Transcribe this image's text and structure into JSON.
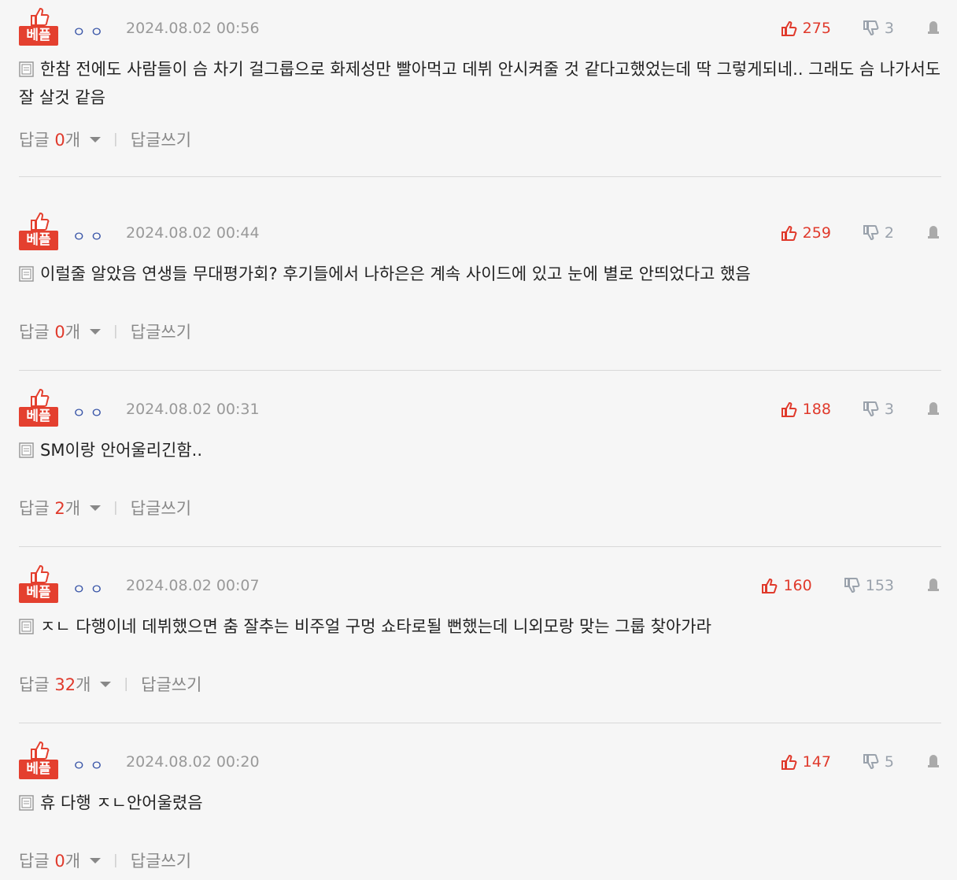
{
  "badge_label": "베플",
  "nick_dots": "ㅇㅇ",
  "reply_prefix": "답글 ",
  "reply_suffix": "개",
  "write_reply": "답글쓰기",
  "colors": {
    "accent": "#e03a2c",
    "badge": "#e4402f",
    "muted": "#888888",
    "date": "#999999"
  },
  "comments": [
    {
      "date": "2024.08.02 00:56",
      "likes": "275",
      "dislikes": "3",
      "text": "한참 전에도 사람들이 슴 차기 걸그룹으로 화제성만 빨아먹고 데뷔 안시켜줄 것 같다고했었는데 딱 그렇게되네.. 그래도 슴 나가서도 잘 살것 같음",
      "reply_count": "0"
    },
    {
      "date": "2024.08.02 00:44",
      "likes": "259",
      "dislikes": "2",
      "text": "이럴줄 알았음 연생들 무대평가회? 후기들에서 나하은은 계속 사이드에 있고 눈에 별로 안띄었다고 했음",
      "reply_count": "0"
    },
    {
      "date": "2024.08.02 00:31",
      "likes": "188",
      "dislikes": "3",
      "text": "SM이랑 안어울리긴함..",
      "reply_count": "2"
    },
    {
      "date": "2024.08.02 00:07",
      "likes": "160",
      "dislikes": "153",
      "text": "ㅈㄴ 다행이네 데뷔했으면 춤 잘추는 비주얼 구멍 쇼타로될 뻔했는데 니외모랑 맞는 그룹 찾아가라",
      "reply_count": "32"
    },
    {
      "date": "2024.08.02 00:20",
      "likes": "147",
      "dislikes": "5",
      "text": "휴 다행 ㅈㄴ안어울렸음",
      "reply_count": "0"
    }
  ]
}
